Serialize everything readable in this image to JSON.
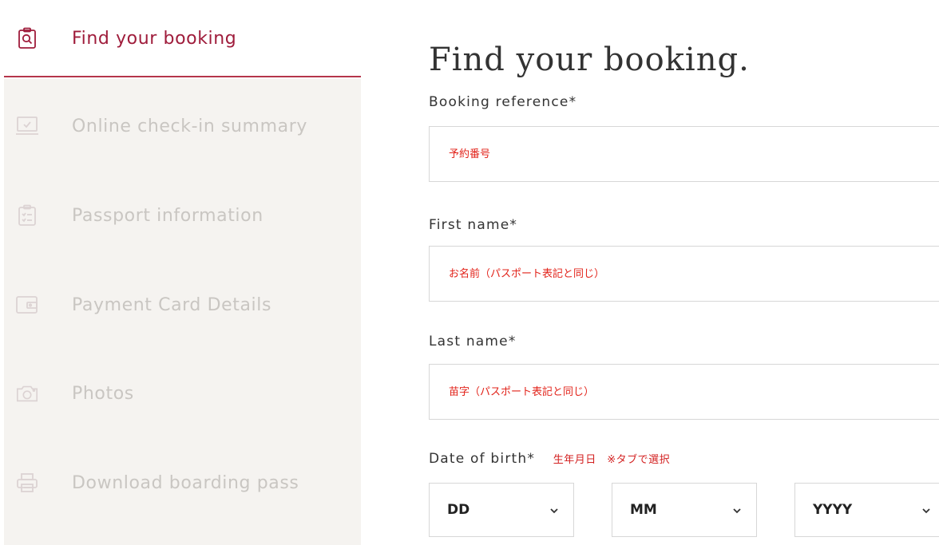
{
  "sidebar": {
    "items": [
      {
        "label": "Find your booking",
        "icon": "clipboard-search-icon",
        "state": "active"
      },
      {
        "label": "Online check-in summary",
        "icon": "laptop-check-icon",
        "state": "disabled"
      },
      {
        "label": "Passport information",
        "icon": "clipboard-list-icon",
        "state": "disabled"
      },
      {
        "label": "Payment Card Details",
        "icon": "wallet-icon",
        "state": "disabled"
      },
      {
        "label": "Photos",
        "icon": "camera-icon",
        "state": "disabled"
      },
      {
        "label": "Download boarding pass",
        "icon": "printer-icon",
        "state": "disabled"
      }
    ]
  },
  "main": {
    "title": "Find your booking.",
    "booking_reference": {
      "label": "Booking reference*",
      "placeholder": "予約番号"
    },
    "first_name": {
      "label": "First name*",
      "placeholder": "お名前（パスポート表記と同じ）"
    },
    "last_name": {
      "label": "Last name*",
      "placeholder": "苗字（パスポート表記と同じ）"
    },
    "date_of_birth": {
      "label": "Date of birth*",
      "note": "生年月日　※タブで選択",
      "day": "DD",
      "month": "MM",
      "year": "YYYY"
    }
  },
  "colors": {
    "accent": "#9f1c3b",
    "divider": "#b5354a",
    "disabled_text": "#c9c6c2",
    "sidebar_bg": "#f5f3f0",
    "hint_red": "#e2231a"
  }
}
